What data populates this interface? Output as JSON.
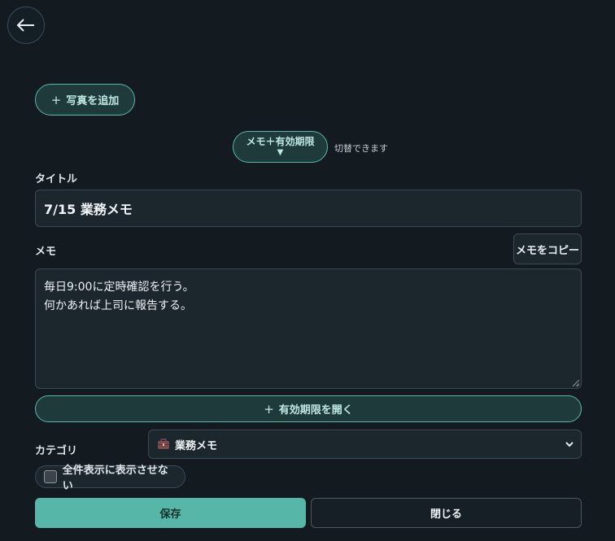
{
  "header": {
    "back_icon": "arrow-left-icon"
  },
  "photo": {
    "add_label": "写真を追加",
    "plus": "+"
  },
  "mode": {
    "toggle_label": "メモ＋有効期限",
    "toggle_arrow": "▼",
    "hint": "切替できます"
  },
  "title": {
    "label": "タイトル",
    "value": "7/15 業務メモ"
  },
  "memo": {
    "label": "メモ",
    "copy_label": "メモをコピー",
    "lines": [
      "毎日9:00に定時確認を行う。",
      "何かあれば上司に報告する。"
    ]
  },
  "expiry": {
    "plus": "+",
    "open_label": "有効期限を開く"
  },
  "category": {
    "label": "カテゴリ",
    "selected": "業務メモ",
    "icon": "briefcase-icon"
  },
  "visibility": {
    "hide_label": "全件表示に表示させない",
    "checked": false
  },
  "actions": {
    "save_label": "保存",
    "close_label": "閉じる"
  },
  "colors": {
    "background": "#131b21",
    "accent": "#56b6a8",
    "accent_border": "#5ab8aa"
  }
}
